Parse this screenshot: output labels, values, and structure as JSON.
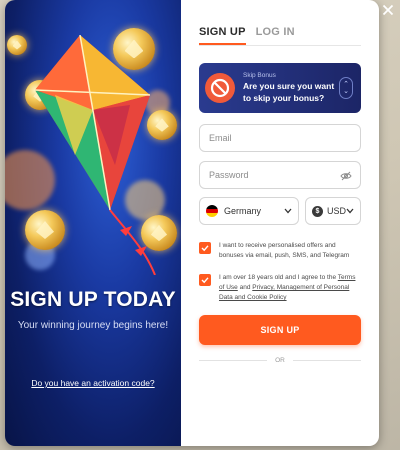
{
  "promo": {
    "title": "SIGN UP TODAY",
    "subtitle": "Your winning journey begins here!",
    "activation_link": "Do you have an activation code?"
  },
  "tabs": [
    {
      "label": "SIGN UP",
      "active": true
    },
    {
      "label": "LOG IN",
      "active": false
    }
  ],
  "bonus": {
    "label": "Skip Bonus",
    "question": "Are you sure you want to skip your bonus?",
    "icon": "no-entry-icon"
  },
  "fields": {
    "email_placeholder": "Email",
    "password_placeholder": "Password"
  },
  "country": {
    "value": "Germany",
    "flag_colors": [
      "#000000",
      "#dd0000",
      "#ffce00"
    ]
  },
  "currency": {
    "value": "USD"
  },
  "consents": {
    "marketing": "I want to receive personalised offers and bonuses via email, push, SMS, and Telegram",
    "age_prefix": "I am over 18 years old and I agree to the",
    "terms_link": "Terms of Use",
    "and_text": "and",
    "privacy_link": "Privacy, Management of Personal Data and Cookie Policy"
  },
  "signup_button": "SIGN UP",
  "or_text": "OR",
  "colors": {
    "accent": "#ff5a1f",
    "banner": "#1c2566"
  }
}
